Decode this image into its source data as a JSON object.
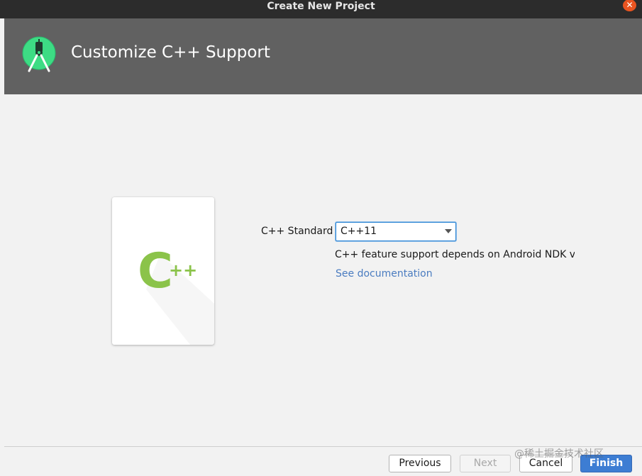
{
  "window": {
    "title": "Create New Project",
    "close_glyph": "✕",
    "close_color": "#e95420"
  },
  "header": {
    "title": "Customize C++ Support",
    "logo_icon": "android-studio-icon",
    "background": "#616161"
  },
  "card": {
    "icon": "cpp-logo-icon",
    "letter": "C",
    "plus": "++",
    "accent": "#8bc34a"
  },
  "form": {
    "standard_label": "C++ Standard",
    "standard_value": "C++11",
    "note": "C++ feature support depends on Android NDK vers",
    "doc_link": "See documentation"
  },
  "buttons": {
    "previous": "Previous",
    "next": "Next",
    "cancel": "Cancel",
    "finish": "Finish"
  },
  "watermark": "@稀土掘金技术社区"
}
